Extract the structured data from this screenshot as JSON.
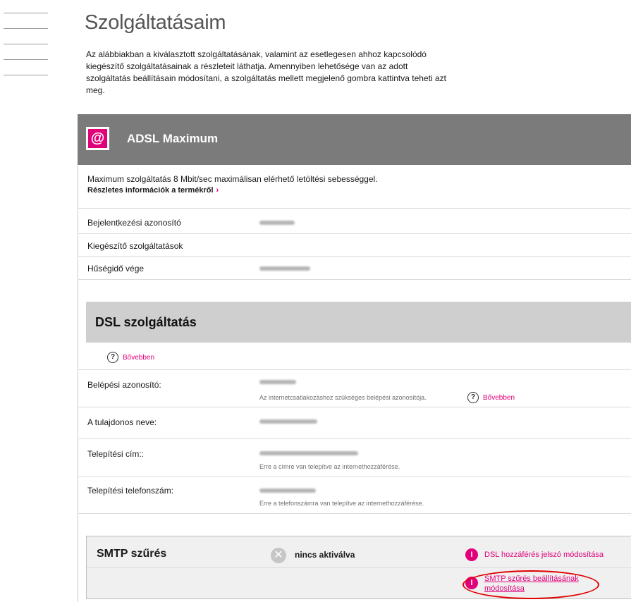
{
  "page": {
    "title": "Szolgáltatásaim",
    "intro": "Az alábbiakban a kiválasztott szolgáltatásának, valamint az esetlegesen ahhoz kapcsolódó kiegészítő szolgáltatásainak a részleteit láthatja. Amennyiben lehetősége van az adott szolgáltatás beállításain módosítani, a szolgáltatás mellett megjelenő gombra kattintva teheti azt meg."
  },
  "adsl": {
    "icon_glyph": "@",
    "icon": "at-sign-icon",
    "title": "ADSL Maximum",
    "description": "Maximum szolgáltatás 8 Mbit/sec maximálisan elérhető letöltési sebességgel.",
    "more_link": "Részletes információk a termékről",
    "arrow": "›",
    "rows": [
      {
        "label": "Bejelentkezési azonosító"
      },
      {
        "label": "Kiegészítő szolgáltatások"
      },
      {
        "label": "Hűségidő vége"
      }
    ]
  },
  "dsl": {
    "title": "DSL szolgáltatás",
    "help_glyph": "?",
    "help_link": "Bővebben",
    "fields": [
      {
        "label": "Belépési azonosító:",
        "note": "Az internetcsatlakozáshoz szükséges belépési azonosítója.",
        "help_link": "Bővebben"
      },
      {
        "label": "A tulajdonos neve:",
        "note": ""
      },
      {
        "label": "Telepítési cím::",
        "note": "Erre a címre van telepítve az internethozzáférése."
      },
      {
        "label": "Telepítési telefonszám:",
        "note": "Erre a telefonszámra van telepítve az internethozzáférése."
      }
    ]
  },
  "smtp": {
    "title": "SMTP szűrés",
    "status_glyph": "✕",
    "status": "nincs aktiválva",
    "badge_glyph": "I",
    "actions": [
      {
        "label": "DSL hozzáférés jelszó módosítása"
      },
      {
        "label": "SMTP szűrés beállításának módosítása"
      }
    ]
  },
  "colors": {
    "accent": "#e2007a",
    "header_dark": "#7b7b7b",
    "header_light": "#cfcfcf",
    "highlight": "#e00000"
  }
}
